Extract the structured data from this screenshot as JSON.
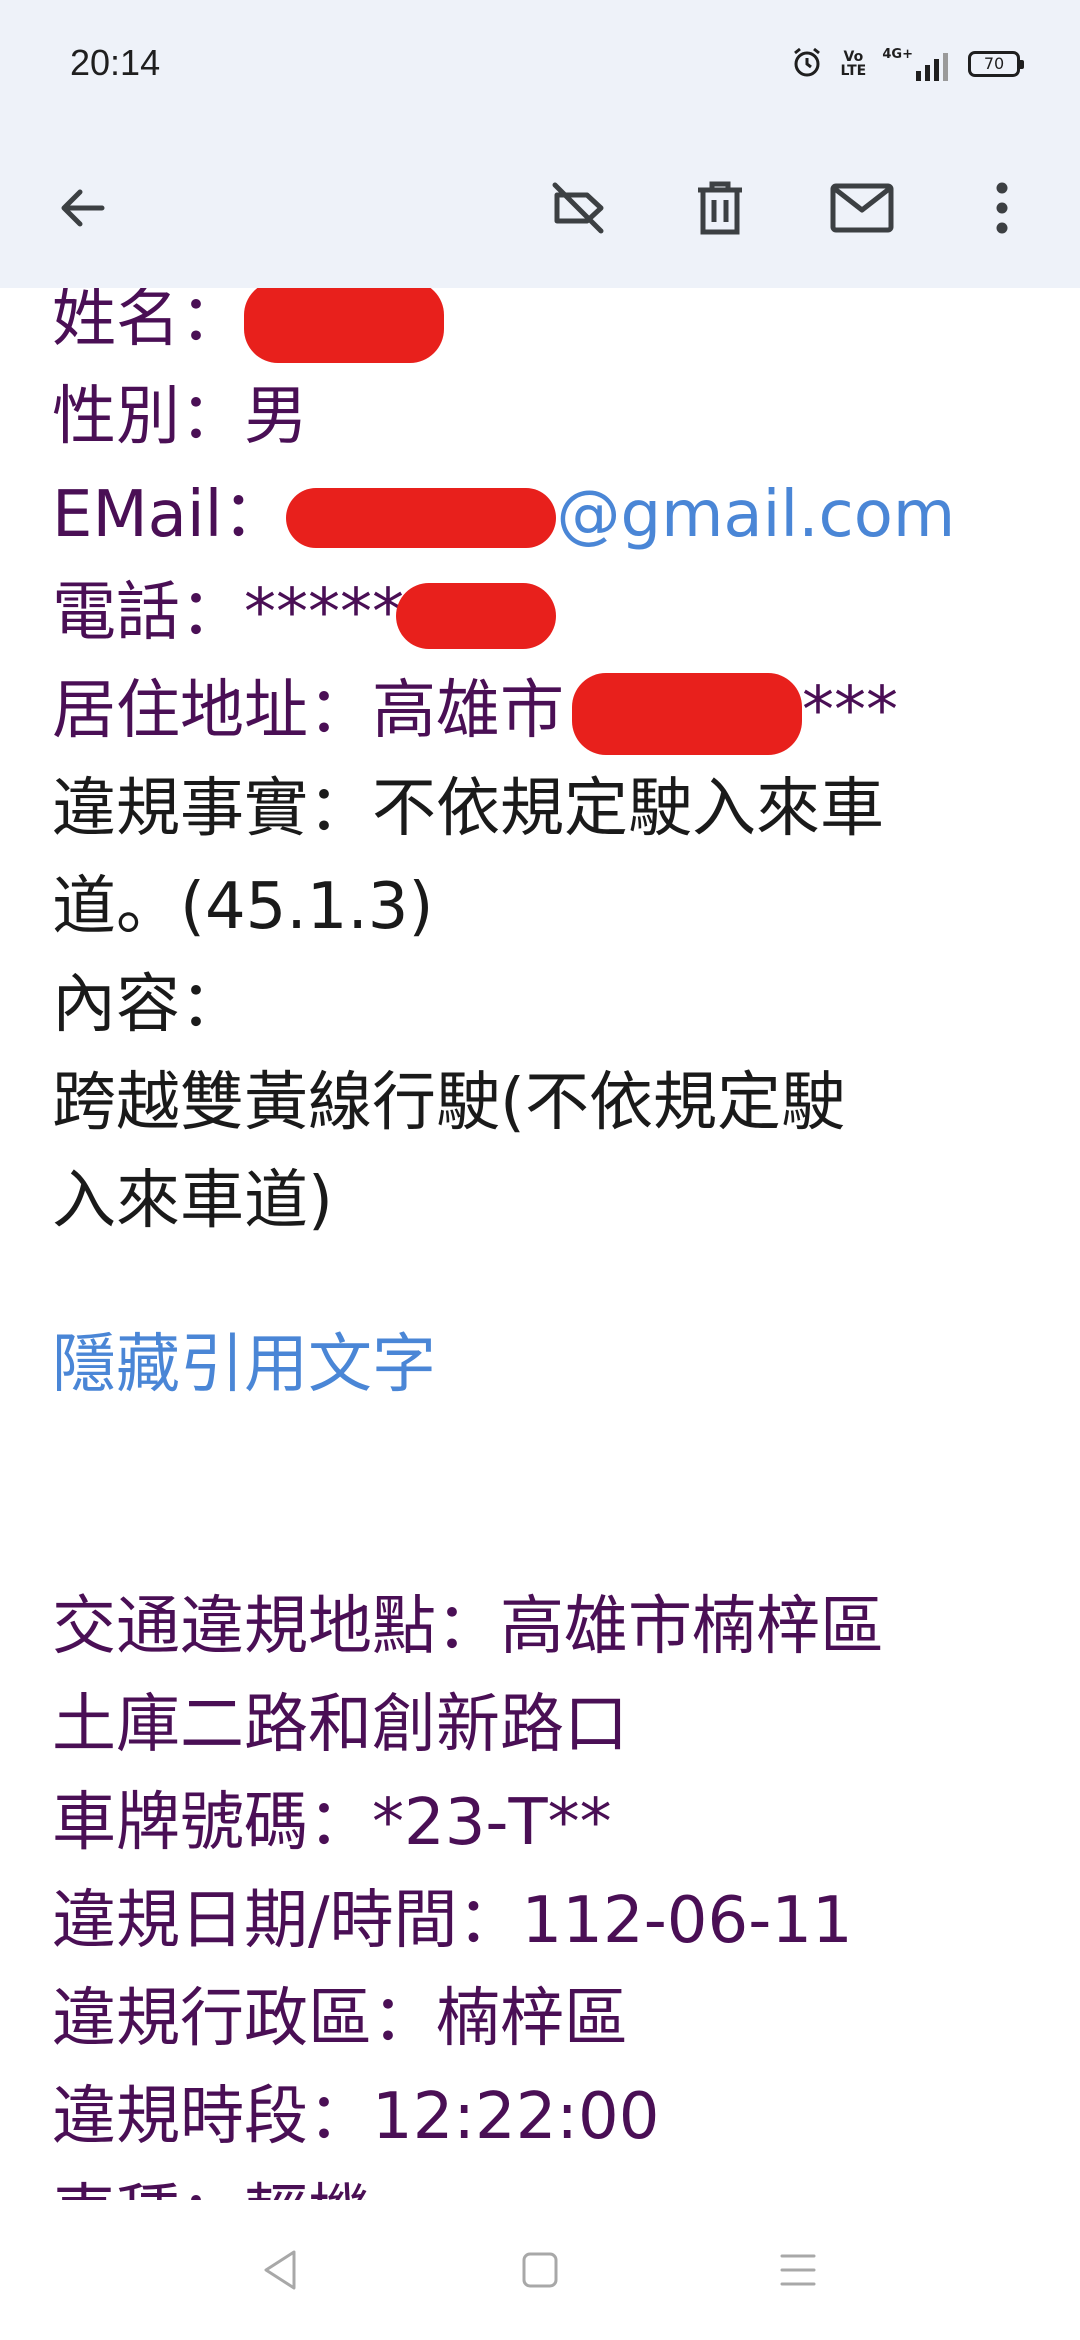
{
  "status_bar": {
    "time": "20:14",
    "volte": "Vo\nLTE",
    "network": "4G+",
    "battery": "70"
  },
  "toolbar": {
    "back_icon": "arrow-left-icon",
    "label_off_icon": "label-off-icon",
    "delete_icon": "trash-icon",
    "mail_icon": "mail-icon",
    "more_icon": "more-vertical-icon"
  },
  "email": {
    "name_label": "姓名：",
    "gender_label": "性別：",
    "gender_value": "男",
    "email_label": "EMail：",
    "email_domain": "@gmail.com",
    "phone_label": "電話：",
    "phone_value": "*****",
    "address_label": "居住地址：",
    "address_city": "高雄市",
    "address_tail": "***",
    "violation_fact_label": "違規事實：",
    "violation_fact_line1": "不依規定駛入來車",
    "violation_fact_line2": "道。(45.1.3)",
    "content_label": "內容：",
    "content_line1": "跨越雙黃線行駛(不依規定駛",
    "content_line2": "入來車道)",
    "hide_quoted": "隱藏引用文字",
    "location_line1": "交通違規地點：高雄市楠梓區",
    "location_line2": "土庫二路和創新路口",
    "plate": "車牌號碼：*23-T**",
    "date_time": "違規日期/時間：112-06-11",
    "district": "違規行政區：楠梓區",
    "time_slot": "違規時段：12:22:00",
    "vehicle_type": "車種：輕機"
  },
  "colors": {
    "header_bg": "#eef2f9",
    "text_purple": "#4a0f55",
    "link_blue": "#4a86d6",
    "redaction_red": "#e8201c"
  }
}
